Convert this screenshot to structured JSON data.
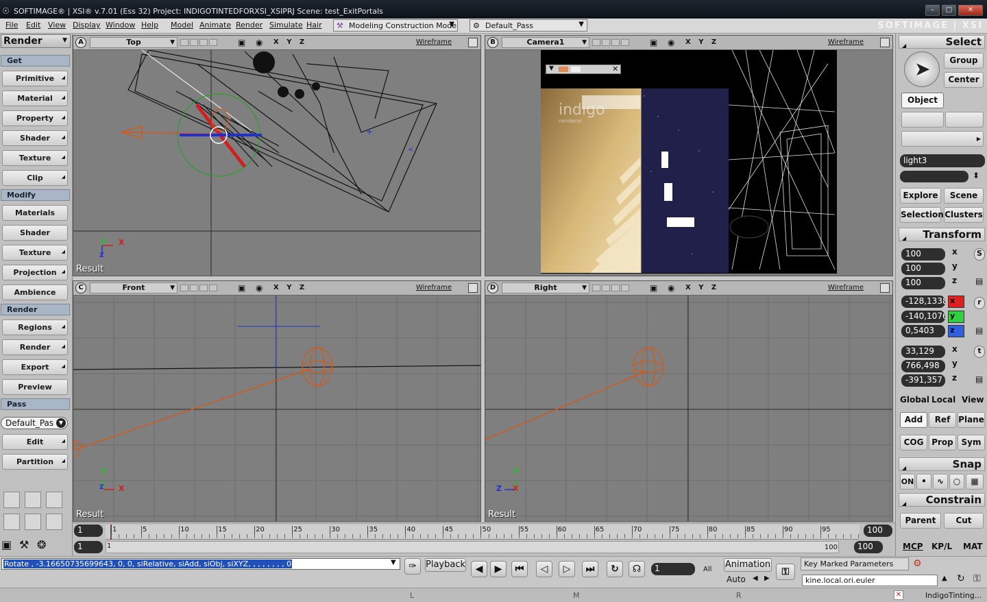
{
  "window": {
    "title": "SOFTIMAGE® | XSI® v.7.01 (Ess 32) Project: INDIGOTINTEDFORXSI_XSIPRJ     Scene: test_ExitPortals",
    "brand": "SOFTIMAGE | XSI"
  },
  "menubar": {
    "items": [
      "File",
      "Edit",
      "View",
      "Display",
      "Window",
      "Help",
      "Model",
      "Animate",
      "Render",
      "Simulate",
      "Hair"
    ],
    "mode": "Modeling Construction Mode",
    "pass": "Default_Pass"
  },
  "left": {
    "toolbar": "Render",
    "sections": {
      "get": "Get",
      "modify": "Modify",
      "render": "Render",
      "pass": "Pass"
    },
    "get_buttons": [
      "Primitive",
      "Material",
      "Property",
      "Shader",
      "Texture",
      "Clip"
    ],
    "modify_buttons": [
      "Materials",
      "Shader",
      "Texture",
      "Projection",
      "Ambience"
    ],
    "render_buttons": [
      "Regions",
      "Render",
      "Export",
      "Preview"
    ],
    "pass_value": "Default_Pas",
    "pass_buttons": [
      "Edit",
      "Partition"
    ]
  },
  "viewports": {
    "a": {
      "letter": "A",
      "camera": "Top",
      "mode": "Wireframe",
      "axes": "X Y Z",
      "result": "Result",
      "ax1": "Y",
      "ax2": "X",
      "ax3": "Z"
    },
    "b": {
      "letter": "B",
      "camera": "Camera1",
      "mode": "Wireframe",
      "axes": "X Y Z"
    },
    "c": {
      "letter": "C",
      "camera": "Front",
      "mode": "Wireframe",
      "axes": "X Y Z",
      "result": "Result",
      "ax1": "Y",
      "ax2": "X",
      "ax3": "Z"
    },
    "d": {
      "letter": "D",
      "camera": "Right",
      "mode": "Wireframe",
      "axes": "X Y Z",
      "result": "Result",
      "ax1": "Y",
      "ax2": "X",
      "ax3": "Z"
    }
  },
  "render_region": {
    "watermark": "indigo",
    "watermark_sub": "renderer"
  },
  "right": {
    "select": "Select",
    "group": "Group",
    "center": "Center",
    "object": "Object",
    "name": "light3",
    "explore": "Explore",
    "scene": "Scene",
    "selection": "Selection",
    "clusters": "Clusters",
    "transform": "Transform",
    "scale": [
      "100",
      "100",
      "100"
    ],
    "rotate": [
      "-128,1338",
      "-140,1076",
      "0,5403"
    ],
    "translate": [
      "33,129",
      "766,498",
      "-391,357"
    ],
    "axis_labels": [
      "x",
      "y",
      "z"
    ],
    "srt": [
      "S",
      "r",
      "t"
    ],
    "ref_row1": [
      "Global",
      "Local",
      "View"
    ],
    "ref_row2": [
      "Add",
      "Ref",
      "Plane"
    ],
    "ref_row3": [
      "COG",
      "Prop",
      "Sym"
    ],
    "snap": "Snap",
    "snap_on": "ON",
    "constrain": "Constrain",
    "parent": "Parent",
    "cut": "Cut",
    "tabs": [
      "MCP",
      "KP/L",
      "MAT"
    ]
  },
  "timeline": {
    "start": "1",
    "end": "100",
    "range_start": "1",
    "range_end": "100",
    "range_label_start": "1",
    "range_label_end": "100",
    "ticks": [
      "1",
      "5",
      "10",
      "15",
      "20",
      "25",
      "30",
      "35",
      "40",
      "45",
      "50",
      "55",
      "60",
      "65",
      "70",
      "75",
      "80",
      "85",
      "90",
      "95"
    ]
  },
  "bottom": {
    "command": "Rotate , -3.16650735699643, 0, 0, siRelative, siAdd, siObj, siXYZ, , , , , , , , 0",
    "playback": "Playback",
    "frame": "1",
    "all": "All",
    "animation": "Animation",
    "auto": "Auto",
    "key_marked": "Key Marked Parameters",
    "param": "kine.local.ori.euler",
    "status_l": "L",
    "status_m": "M",
    "status_r": "R",
    "task": "IndigoTinting..."
  },
  "colors": {
    "viewport_bg": "#7f7f7f",
    "light_orange": "#d05a1e",
    "selection_green": "#2aa02a",
    "axis_red": "#d02020",
    "axis_blue": "#2030d0"
  }
}
